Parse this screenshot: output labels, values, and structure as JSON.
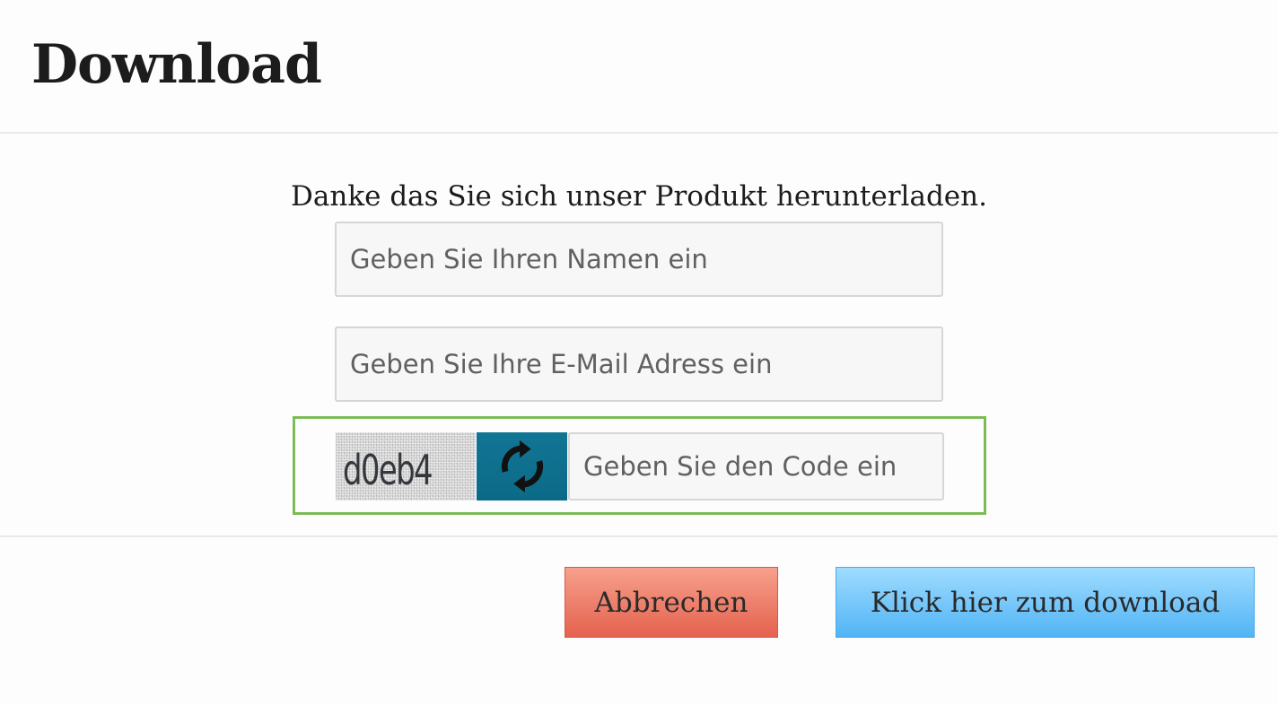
{
  "header": {
    "title": "Download"
  },
  "body": {
    "thanks_text": "Danke das Sie sich unser Produkt herunterladen.",
    "name_field": {
      "placeholder": "Geben Sie Ihren Namen ein",
      "value": ""
    },
    "email_field": {
      "placeholder": "Geben Sie Ihre E-Mail Adress ein",
      "value": ""
    },
    "captcha": {
      "code": "d0eb4",
      "refresh_icon": "refresh-icon",
      "input_placeholder": "Geben Sie den Code ein",
      "input_value": "",
      "highlight_color": "#7dbb56"
    }
  },
  "footer": {
    "cancel_label": "Abbrechen",
    "download_label": "Klick hier zum download",
    "cancel_color": "#e4624e",
    "download_color": "#52b4f5"
  }
}
